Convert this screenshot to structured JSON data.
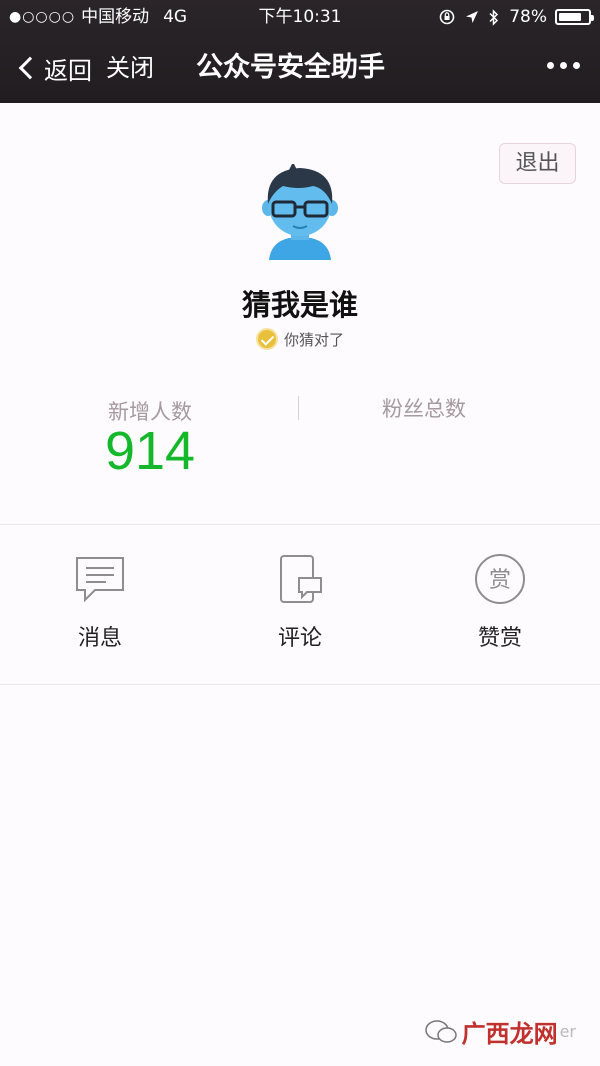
{
  "status_bar": {
    "signal": "●○○○○",
    "carrier": "中国移动",
    "network": "4G",
    "time": "下午10:31",
    "battery": "78%",
    "battery_level": 0.78
  },
  "nav": {
    "back_label": "返回",
    "close_label": "关闭",
    "title": "公众号安全助手"
  },
  "profile": {
    "logout_label": "退出",
    "name": "猜我是谁",
    "verified_text": "你猜对了"
  },
  "stats": {
    "new_followers_label": "新增人数",
    "new_followers_value": "914",
    "total_fans_label": "粉丝总数"
  },
  "actions": [
    {
      "label": "消息",
      "icon": "message-icon"
    },
    {
      "label": "评论",
      "icon": "comment-icon"
    },
    {
      "label": "赞赏",
      "icon": "reward-icon",
      "icon_text": "赏"
    }
  ],
  "watermark": {
    "brand": "广西龙网",
    "tail": "er"
  },
  "colors": {
    "topbar": "#241f22",
    "accent_green": "#14b82a",
    "badge_gold": "#e9c03a",
    "watermark_red": "#c0302d"
  }
}
